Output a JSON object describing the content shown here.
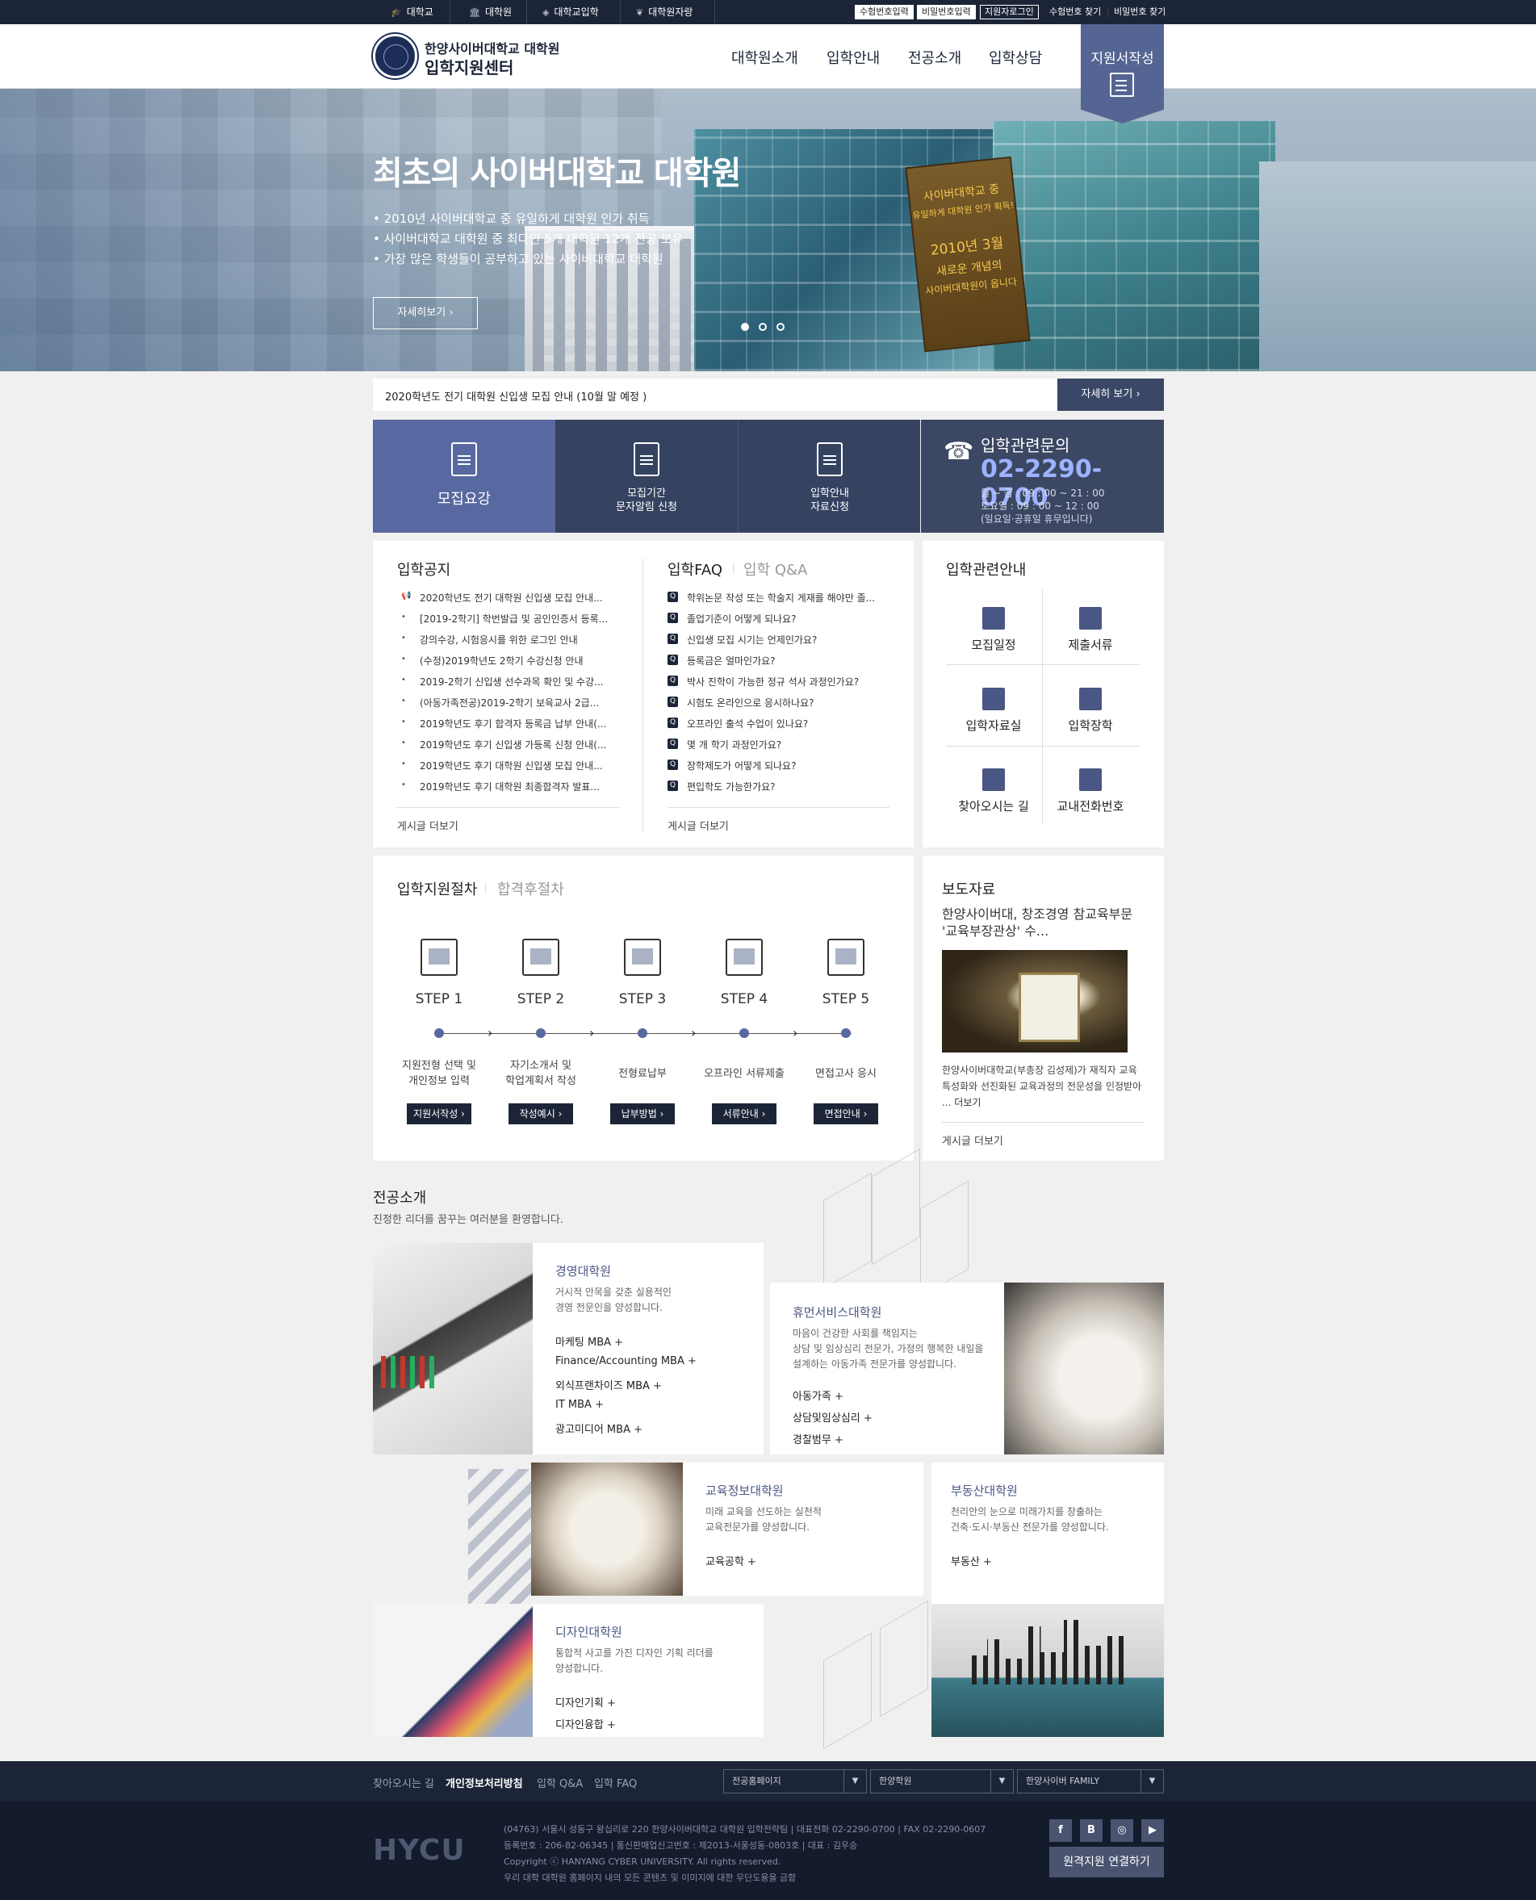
{
  "topbar": {
    "links": [
      "대학교",
      "대학원",
      "대학교입학",
      "대학원자랑"
    ],
    "buttons": [
      "수험번호입력",
      "비밀번호입력",
      "지원자로그인"
    ],
    "text_links": [
      "수험번호 찾기",
      "비밀번호 찾기"
    ]
  },
  "header": {
    "logo_line1": "한양사이버대학교 대학원",
    "logo_line2": "입학지원센터",
    "nav": [
      "대학원소개",
      "입학안내",
      "전공소개",
      "입학상담"
    ],
    "apply": "지원서작성"
  },
  "hero": {
    "title": "최초의 사이버대학교 대학원",
    "bullets": [
      "• 2010년 사이버대학교 중 유일하게 대학원 인가 취득",
      "• 사이버대학교 대학원 중 최다인 5개 대학원 12개 전공 보유",
      "• 가장 많은 학생들이 공부하고 있는 사이버대학교 대학원"
    ],
    "more": "자세히보기",
    "banner_text": [
      "사이버대학교 중",
      "유일하게 대학원 인가 획득!",
      "2010년 3월",
      "새로운 개념의",
      "사이버대학원이 옵니다"
    ]
  },
  "notice_bar": {
    "text": "2020학년도 전기 대학원 신입생 모집 안내 (10월 말 예정 )",
    "button": "자세히 보기"
  },
  "quick": [
    {
      "label": "모집요강"
    },
    {
      "label": "모집기간\n문자알림 신청"
    },
    {
      "label": "입학안내\n자료신청"
    }
  ],
  "contact": {
    "title": "입학관련문의",
    "phone": "02-2290-0700",
    "hours": [
      "월 ~ 금 : 09 : 00 ~ 21 : 00",
      "토요일 : 09 : 00 ~ 12 : 00",
      "(일요일·공휴일 휴무입니다)"
    ]
  },
  "notices": {
    "title": "입학공지",
    "items": [
      "2020학년도 전기 대학원 신입생 모집 안내...",
      "[2019-2학기] 학번발급 및 공인인증서 등록...",
      "강의수강, 시험응시를 위한 로그인 안내",
      "(수정)2019학년도 2학기 수강신청 안내",
      "2019-2학기 신입생 선수과목 확인 및 수강...",
      "(아동가족전공)2019-2학기 보육교사 2급...",
      "2019학년도 후기 합격자 등록금 납부 안내(...",
      "2019학년도 후기 신입생 가등록 신청 안내(...",
      "2019학년도 후기 대학원 신입생 모집 안내...",
      "2019학년도 후기 대학원 최종합격자 발표..."
    ],
    "more": "게시글 더보기"
  },
  "faq": {
    "title": "입학FAQ",
    "title2": "입학 Q&A",
    "items": [
      "학위논문 작성 또는 학술지 게재를 해야만 졸...",
      "졸업기준이 어떻게 되나요?",
      "신입생 모집 시기는 언제인가요?",
      "등록금은 얼마인가요?",
      "박사 진학이 가능한 정규 석사 과정인가요?",
      "시험도 온라인으로 응시하나요?",
      "오프라인 출석 수업이 있나요?",
      "몇 개 학기 과정인가요?",
      "장학제도가 어떻게 되나요?",
      "편입학도 가능한가요?"
    ],
    "more": "게시글 더보기"
  },
  "guide": {
    "title": "입학관련안내",
    "items": [
      {
        "label": "모집일정",
        "icon": "calendar-icon"
      },
      {
        "label": "제출서류",
        "icon": "tray-icon"
      },
      {
        "label": "입학자료실",
        "icon": "folder-icon"
      },
      {
        "label": "입학장학",
        "icon": "building-icon"
      },
      {
        "label": "찾아오시는 길",
        "icon": "map-pin-icon"
      },
      {
        "label": "교내전화번호",
        "icon": "phone-icon"
      }
    ]
  },
  "process": {
    "title": "입학지원절차",
    "title2": "합격후절차",
    "steps": [
      {
        "label": "STEP 1",
        "desc": "지원전형 선택 및\n개인정보 입력",
        "button": "지원서작성"
      },
      {
        "label": "STEP 2",
        "desc": "자기소개서 및\n학업계획서 작성",
        "button": "작성예시"
      },
      {
        "label": "STEP 3",
        "desc": "전형료납부",
        "button": "납부방법"
      },
      {
        "label": "STEP 4",
        "desc": "오프라인 서류제출",
        "button": "서류안내"
      },
      {
        "label": "STEP 5",
        "desc": "면접고사 응시",
        "button": "면접안내"
      }
    ]
  },
  "press": {
    "title": "보도자료",
    "headline": "한양사이버대, 창조경영 참교육부문 '교육부장관상' 수...",
    "body": "한양사이버대학교(부총장 김성제)가 재직자 교육 특성화와 선진화된 교육과정의 전문성을 인정받아 ...",
    "body_more": "더보기",
    "more": "게시글 더보기"
  },
  "majors": {
    "title": "전공소개",
    "subtitle": "진정한 리더를 꿈꾸는 여러분을 환영합니다.",
    "schools": [
      {
        "name": "경영대학원",
        "desc": "거시적 안목을 갖춘 실용적인\n경영 전문인을 양성합니다.",
        "links": [
          "마케팅 MBA",
          "Finance/Accounting MBA",
          "외식프랜차이즈 MBA",
          "IT MBA",
          "광고미디어 MBA"
        ]
      },
      {
        "name": "휴먼서비스대학원",
        "desc": "마음이 건강한 사회를 책임지는\n상담 및 임상심리 전문가, 가정의 행복한 내일을\n설계하는 아동가족 전문가를 양성합니다.",
        "links": [
          "아동가족",
          "상담및임상심리",
          "경찰범무"
        ]
      },
      {
        "name": "교육정보대학원",
        "desc": "미래 교육을 선도하는 실천적\n교육전문가를 양성합니다.",
        "links": [
          "교육공학"
        ]
      },
      {
        "name": "부동산대학원",
        "desc": "천리안의 눈으로 미래가치를 창출하는\n건축·도시·부동산 전문가를 양성합니다.",
        "links": [
          "부동산"
        ]
      },
      {
        "name": "디자인대학원",
        "desc": "통합적 사고를 가진 디자인 기획 리더를\n양성합니다.",
        "links": [
          "디자인기획",
          "디자인융합"
        ]
      }
    ]
  },
  "footer": {
    "links": [
      "찾아오시는 길",
      "개인정보처리방침",
      "입학 Q&A",
      "입학 FAQ"
    ],
    "selects": [
      "전공홈페이지",
      "한양학원",
      "한양사이버 FAMILY"
    ],
    "logo": "HYCU",
    "info": [
      "(04763) 서울시 성동구 왕십리로 220 한양사이버대학교 대학원 입학전략팀  |  대표전화 02-2290-0700  |  FAX 02-2290-0607",
      "등록번호 : 206-82-06345 | 통신판매업신고번호 : 제2013-서울성동-0803호 | 대표 : 김우승",
      "Copyright ⓒ HANYANG CYBER UNIVERSITY. All rights reserved.",
      "우리 대학 대학원 홈페이지 내의 모든 콘텐츠 및 이미지에 대한 무단도용을 금함"
    ],
    "sns": [
      "f",
      "B",
      "◎",
      "▶"
    ],
    "family_button": "원격지원 연결하기"
  }
}
